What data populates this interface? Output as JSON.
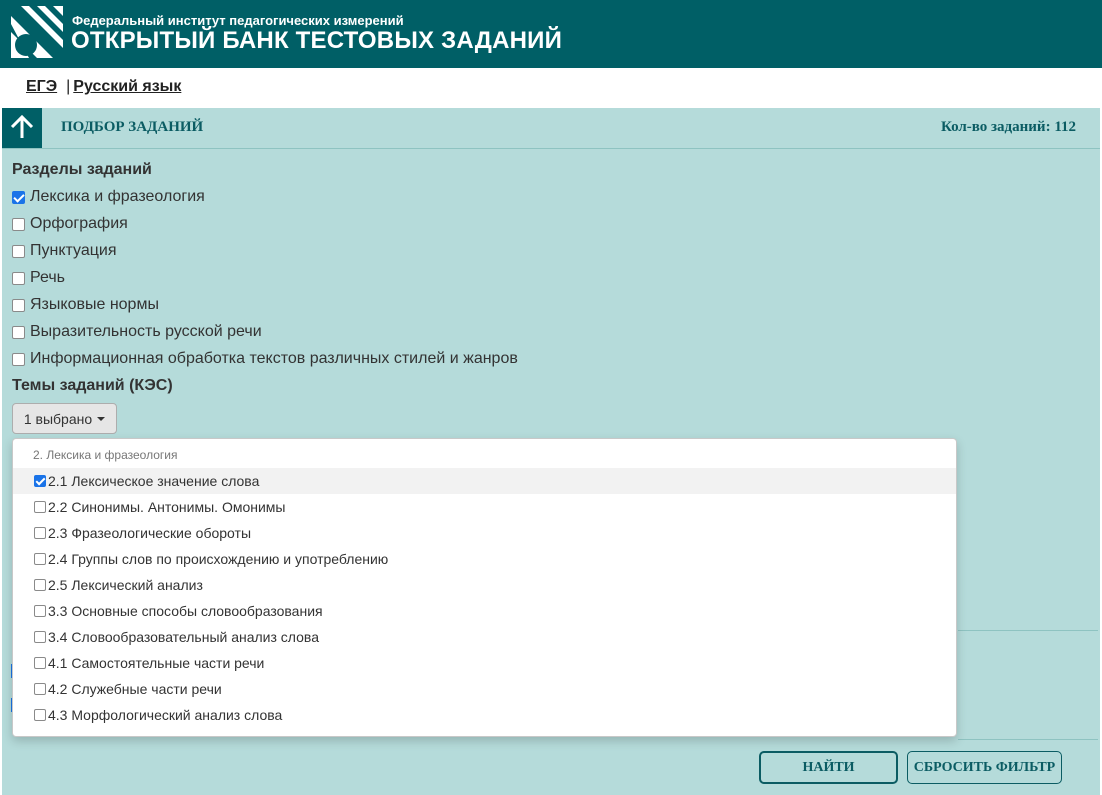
{
  "header": {
    "org_name": "Федеральный институт педагогических измерений",
    "bank_title": "ОТКРЫТЫЙ БАНК ТЕСТОВЫХ ЗАДАНИЙ",
    "colors": {
      "primary": "#005f66",
      "panel": "#b5dbda",
      "accent": "#1a73e8"
    }
  },
  "breadcrumb": {
    "exam": "ЕГЭ",
    "separator": "|",
    "subject": "Русский язык"
  },
  "panel": {
    "title": "ПОДБОР ЗАДАНИЙ",
    "count_label": "Кол-во заданий: 112",
    "up_icon": "arrow-up-icon"
  },
  "sections": {
    "label": "Разделы заданий",
    "items": [
      {
        "label": "Лексика и фразеология",
        "checked": true
      },
      {
        "label": "Орфография",
        "checked": false
      },
      {
        "label": "Пунктуация",
        "checked": false
      },
      {
        "label": "Речь",
        "checked": false
      },
      {
        "label": "Языковые нормы",
        "checked": false
      },
      {
        "label": "Выразительность русской речи",
        "checked": false
      },
      {
        "label": "Информационная обработка текстов различных стилей и жанров",
        "checked": false
      }
    ]
  },
  "topics": {
    "label": "Темы заданий (КЭС)",
    "button_label": "1 выбрано",
    "dropdown": {
      "group_label": "2. Лексика и фразеология",
      "items": [
        {
          "label": "2.1 Лексическое значение слова",
          "checked": true
        },
        {
          "label": "2.2 Синонимы. Антонимы. Омонимы",
          "checked": false
        },
        {
          "label": "2.3 Фразеологические обороты",
          "checked": false
        },
        {
          "label": "2.4 Группы слов по происхождению и употреблению",
          "checked": false
        },
        {
          "label": "2.5 Лексический анализ",
          "checked": false
        },
        {
          "label": "3.3 Основные способы словообразования",
          "checked": false
        },
        {
          "label": "3.4 Словообразовательный анализ слова",
          "checked": false
        },
        {
          "label": "4.1 Самостоятельные части речи",
          "checked": false
        },
        {
          "label": "4.2 Служебные части речи",
          "checked": false
        },
        {
          "label": "4.3 Морфологический анализ слова",
          "checked": false
        }
      ]
    }
  },
  "actions": {
    "find_label": "НАЙТИ",
    "reset_label": "СБРОСИТЬ ФИЛЬТР"
  }
}
